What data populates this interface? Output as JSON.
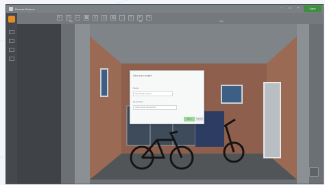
{
  "app": {
    "title": "Roomle Rubens",
    "save_label": "Save",
    "window_controls": [
      "minimize",
      "maximize",
      "close"
    ]
  },
  "toolbar": {
    "tools": [
      "select",
      "wall",
      "door",
      "window",
      "stairs",
      "object",
      "floor",
      "measure",
      "text",
      "undo",
      "redo"
    ],
    "group_labels": [
      "Draw",
      "Edit",
      "View"
    ]
  },
  "left_rail": {
    "active_item": "plan",
    "items": [
      "plan",
      "objects",
      "materials",
      "settings",
      "help"
    ]
  },
  "dialog": {
    "title": "Save your project",
    "name_label": "Name",
    "name_value": "My garage project",
    "description_label": "Description",
    "description_placeholder": "Add a short description",
    "save_label": "Save",
    "cancel_label": "Cancel"
  },
  "colors": {
    "accent_orange": "#e38d24",
    "save_green": "#3f8f43",
    "wall_brick": "#9b6a55",
    "door_white": "#e7e9eb"
  },
  "scene": {
    "description_objects": [
      "garage",
      "bicycle",
      "bicycle",
      "cabinet",
      "window",
      "door"
    ]
  }
}
